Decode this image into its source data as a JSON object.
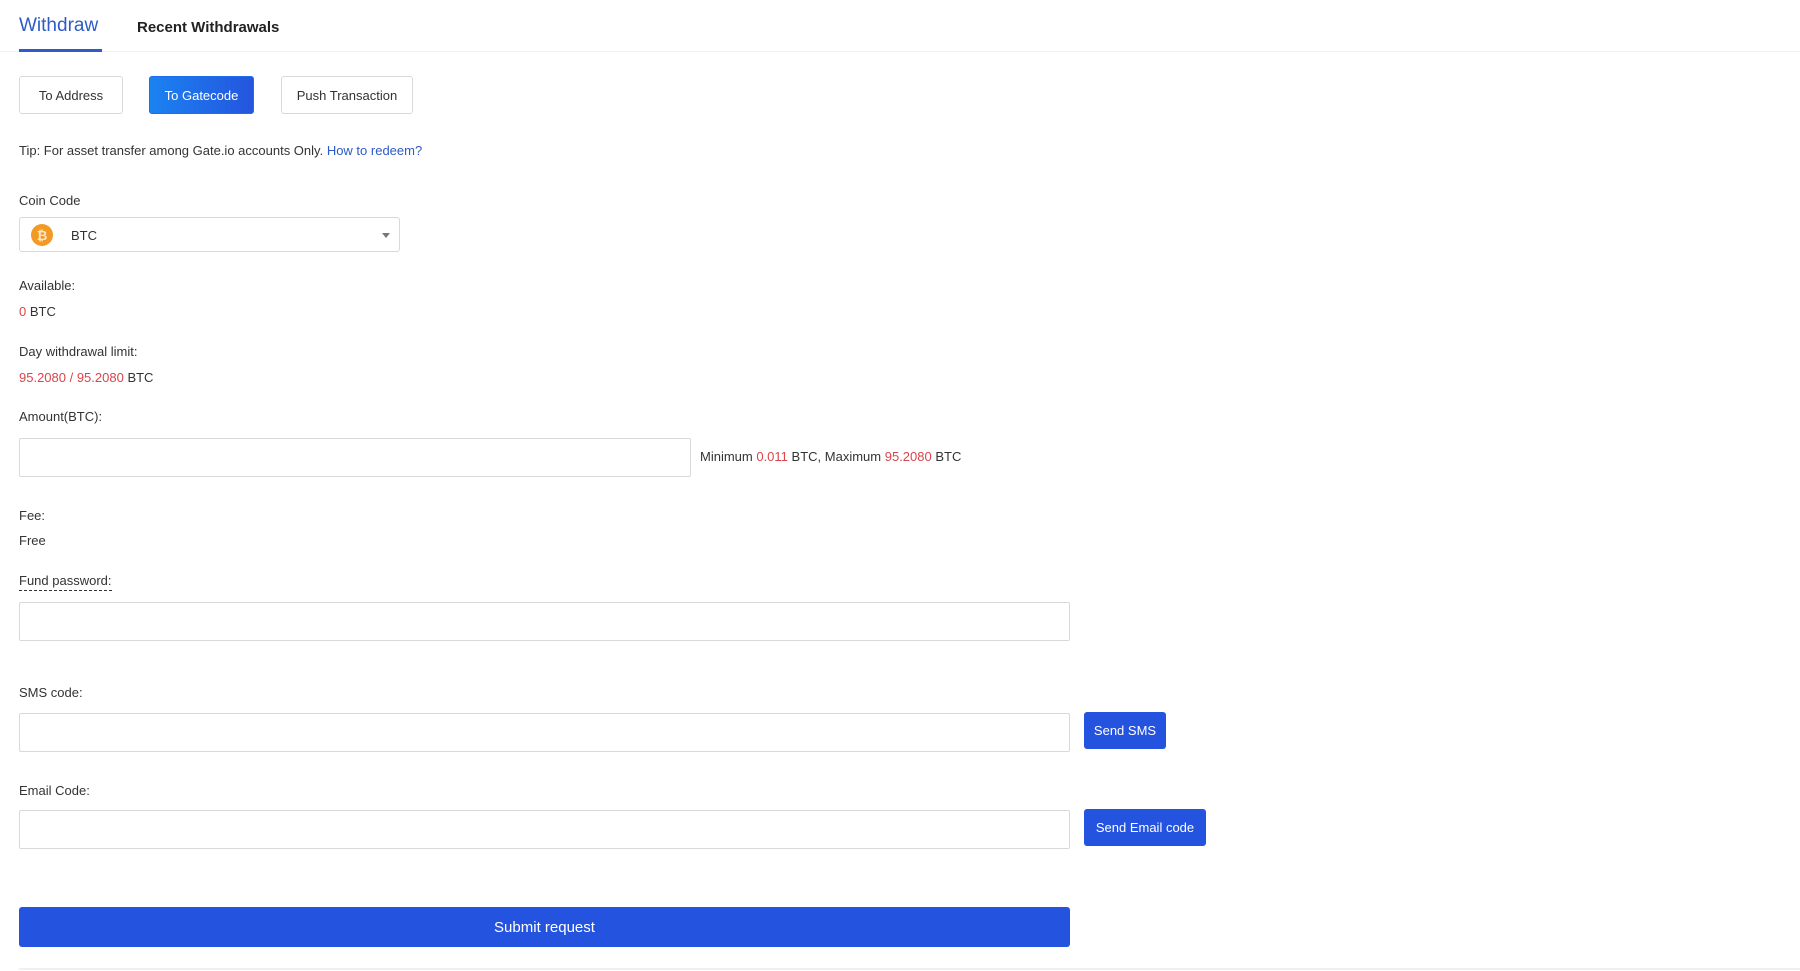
{
  "tabs": {
    "items": [
      {
        "label": "Withdraw",
        "active": true
      },
      {
        "label": "Recent Withdrawals",
        "active": false
      }
    ]
  },
  "modes": {
    "items": [
      {
        "label": "To Address",
        "active": false
      },
      {
        "label": "To Gatecode",
        "active": true
      },
      {
        "label": "Push Transaction",
        "active": false
      }
    ]
  },
  "tip": {
    "text": "Tip: For asset transfer among Gate.io accounts Only. ",
    "link": "How to redeem?"
  },
  "coin": {
    "label": "Coin Code",
    "selected": "BTC",
    "icon": "bitcoin-icon",
    "icon_glyph": "₿",
    "icon_color": "#f39a26"
  },
  "available": {
    "label": "Available:",
    "amount": "0",
    "unit": " BTC"
  },
  "day_limit": {
    "label": "Day withdrawal limit:",
    "value": "95.2080 / 95.2080",
    "unit": " BTC"
  },
  "amount": {
    "label": "Amount(BTC):",
    "value": "",
    "placeholder": "",
    "min_prefix": "Minimum ",
    "min_value": "0.011",
    "min_suffix": " BTC,  Maximum ",
    "max_value": "95.2080",
    "max_suffix": " BTC"
  },
  "fee": {
    "label": "Fee:",
    "value": "Free"
  },
  "fund_password": {
    "label": "Fund password:",
    "value": ""
  },
  "sms": {
    "label": "SMS code:",
    "value": "",
    "button": "Send SMS"
  },
  "email": {
    "label": "Email Code:",
    "value": "",
    "button": "Send Email code"
  },
  "submit": {
    "label": "Submit request"
  },
  "colors": {
    "accent": "#2e5bc6",
    "button_blue": "#2453e0",
    "highlight_red": "#d8454a"
  }
}
